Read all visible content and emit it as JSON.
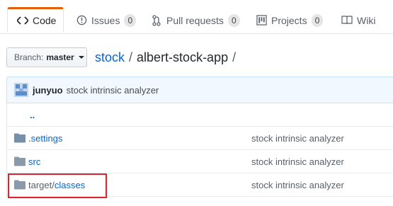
{
  "tabs": [
    {
      "label": "Code",
      "icon": "code-icon",
      "active": true
    },
    {
      "label": "Issues",
      "icon": "issue-icon",
      "count": "0"
    },
    {
      "label": "Pull requests",
      "icon": "pull-request-icon",
      "count": "0"
    },
    {
      "label": "Projects",
      "icon": "project-icon",
      "count": "0"
    },
    {
      "label": "Wiki",
      "icon": "book-icon"
    }
  ],
  "branch": {
    "prefix": "Branch:",
    "name": "master"
  },
  "breadcrumb": {
    "owner": "stock",
    "repo": "albert-stock-app",
    "sep": "/"
  },
  "commit": {
    "author": "junyuo",
    "message": "stock intrinsic analyzer"
  },
  "files": [
    {
      "name": "..",
      "type": "parent",
      "message": ""
    },
    {
      "name": ".settings",
      "type": "dir",
      "message": "stock intrinsic analyzer"
    },
    {
      "name": "src",
      "type": "dir",
      "message": "stock intrinsic analyzer"
    },
    {
      "name_prefix": "target/",
      "name_suffix": "classes",
      "type": "dir",
      "message": "stock intrinsic analyzer"
    }
  ],
  "colors": {
    "accent_tab": "#e36209",
    "link": "#0366d6",
    "highlight": "#d9262c"
  }
}
